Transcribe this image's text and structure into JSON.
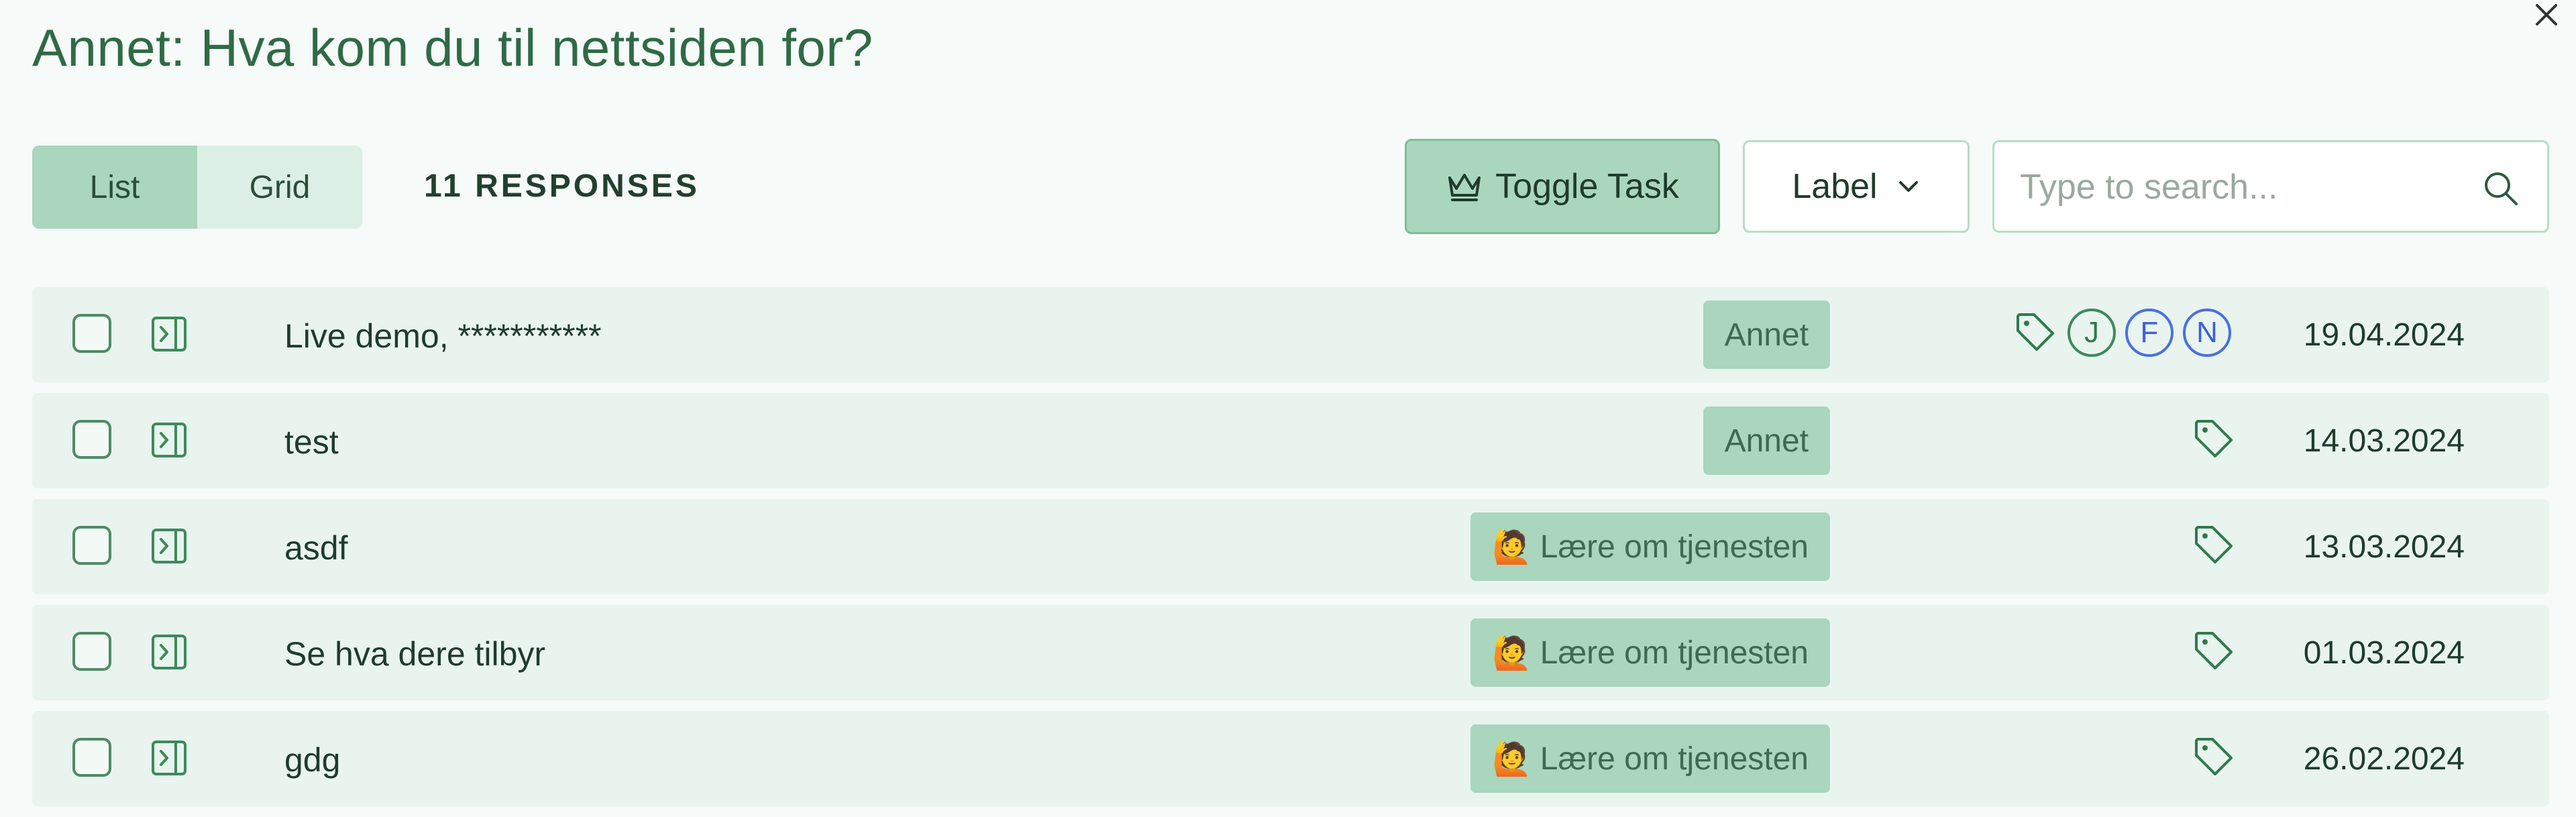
{
  "header": {
    "title": "Annet: Hva kom du til nettsiden for?"
  },
  "toolbar": {
    "view_list": "List",
    "view_grid": "Grid",
    "count": "11 RESPONSES",
    "toggle_task": "Toggle Task",
    "label": "Label",
    "search_placeholder": "Type to search..."
  },
  "responses": [
    {
      "text": "Live demo, ***********",
      "category": "Annet",
      "category_emoji": "",
      "assignees": [
        "J",
        "F",
        "N"
      ],
      "date": "19.04.2024"
    },
    {
      "text": "test",
      "category": "Annet",
      "category_emoji": "",
      "assignees": [],
      "date": "14.03.2024"
    },
    {
      "text": "asdf",
      "category": "Lære om tjenesten",
      "category_emoji": "🙋",
      "assignees": [],
      "date": "13.03.2024"
    },
    {
      "text": "Se hva dere tilbyr",
      "category": "Lære om tjenesten",
      "category_emoji": "🙋",
      "assignees": [],
      "date": "01.03.2024"
    },
    {
      "text": "gdg",
      "category": "Lære om tjenesten",
      "category_emoji": "🙋",
      "assignees": [],
      "date": "26.02.2024"
    }
  ],
  "colors": {
    "accent": "#a9d6bd",
    "title": "#2f6a46",
    "assignee_green": "#3c8a5d",
    "assignee_blue": "#4a6fe6"
  },
  "icons": [
    "close-icon",
    "crown-icon",
    "chevron-down-icon",
    "search-icon",
    "open-panel-icon",
    "tag-icon"
  ]
}
